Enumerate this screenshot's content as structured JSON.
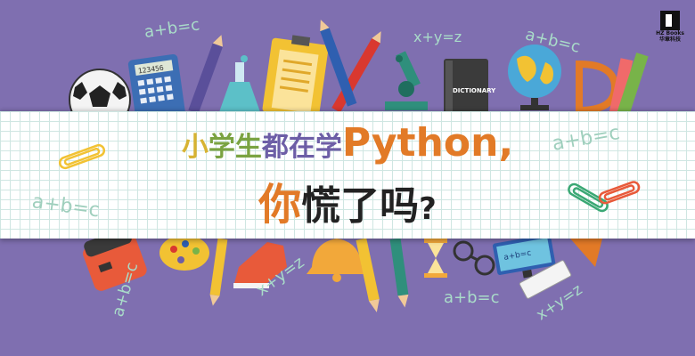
{
  "headline": {
    "line1": {
      "chars": [
        {
          "t": "小",
          "color": "#d7b332"
        },
        {
          "t": "学",
          "color": "#7aa341"
        },
        {
          "t": "生",
          "color": "#7aa341"
        },
        {
          "t": "都",
          "color": "#6d5ea6"
        },
        {
          "t": "在",
          "color": "#6d5ea6"
        },
        {
          "t": "学",
          "color": "#6d5ea6"
        }
      ],
      "word": "Python",
      "punct": ","
    },
    "line2": {
      "chars": [
        {
          "t": "你",
          "color": "#e27a27"
        },
        {
          "t": "慌",
          "color": "#222222"
        },
        {
          "t": "了",
          "color": "#222222"
        },
        {
          "t": "吗",
          "color": "#222222"
        },
        {
          "t": "?",
          "color": "#222222"
        }
      ]
    }
  },
  "doodles": {
    "a": "a+b=c",
    "b": "x+y=z"
  },
  "book_label": "DICTIONARY",
  "calc_display": "123456",
  "publisher": {
    "mark": "HZ Books",
    "name": "华章科技"
  },
  "colors": {
    "background": "#7f6fb0",
    "grid_line": "#cfe6e2",
    "accent_orange": "#e27a27",
    "doodle_green": "#a9dcc9"
  }
}
